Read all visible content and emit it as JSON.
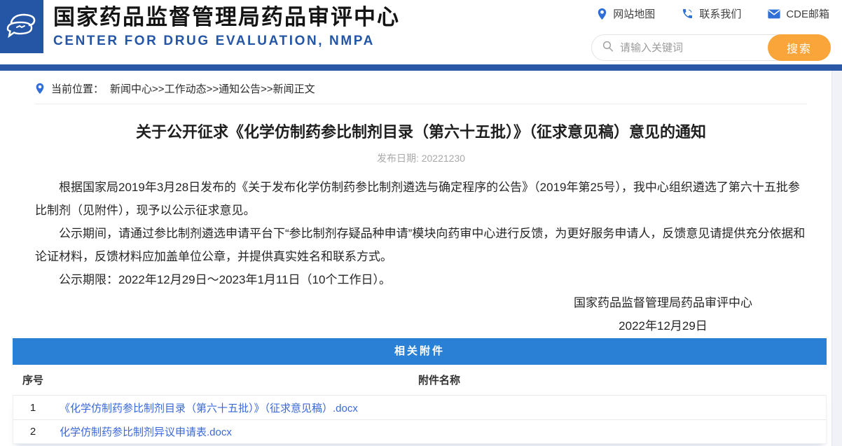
{
  "header": {
    "site_name_cn": "国家药品监督管理局药品审评中心",
    "site_name_en": "CENTER FOR DRUG EVALUATION, NMPA",
    "utility_links": [
      {
        "icon": "location-pin-icon",
        "label": "网站地图"
      },
      {
        "icon": "phone-icon",
        "label": "联系我们"
      },
      {
        "icon": "envelope-icon",
        "label": "CDE邮箱"
      }
    ],
    "search": {
      "placeholder": "请输入关键词",
      "button_label": "搜索"
    }
  },
  "breadcrumb": {
    "label": "当前位置：",
    "separator": ">>",
    "items": [
      "新闻中心",
      "工作动态",
      "通知公告",
      "新闻正文"
    ]
  },
  "article": {
    "title": "关于公开征求《化学仿制药参比制剂目录（第六十五批）》（征求意见稿）意见的通知",
    "publish_date_label": "发布日期:",
    "publish_date": "20221230",
    "paragraphs": [
      "根据国家局2019年3月28日发布的《关于发布化学仿制药参比制剂遴选与确定程序的公告》（2019年第25号），我中心组织遴选了第六十五批参比制剂（见附件），现予以公示征求意见。",
      "公示期间，请通过参比制剂遴选申请平台下“参比制剂存疑品种申请”模块向药审中心进行反馈，为更好服务申请人，反馈意见请提供充分依据和论证材料，反馈材料应加盖单位公章，并提供真实姓名和联系方式。",
      "公示期限：2022年12月29日～2023年1月11日（10个工作日）。"
    ],
    "signature": {
      "org": "国家药品监督管理局药品审评中心",
      "date": "2022年12月29日"
    }
  },
  "attachments": {
    "title": "相关附件",
    "columns": {
      "index": "序号",
      "name": "附件名称"
    },
    "rows": [
      {
        "index": "1",
        "name": "《化学仿制药参比制剂目录（第六十五批）》（征求意见稿）.docx"
      },
      {
        "index": "2",
        "name": "化学仿制药参比制剂异议申请表.docx"
      }
    ]
  },
  "colors": {
    "brand_navy": "#2456a5",
    "header_bar_blue": "#2b57a7",
    "table_header_blue": "#2a80d5",
    "link_blue": "#3a68d8",
    "search_button_orange": "#faa53a"
  }
}
